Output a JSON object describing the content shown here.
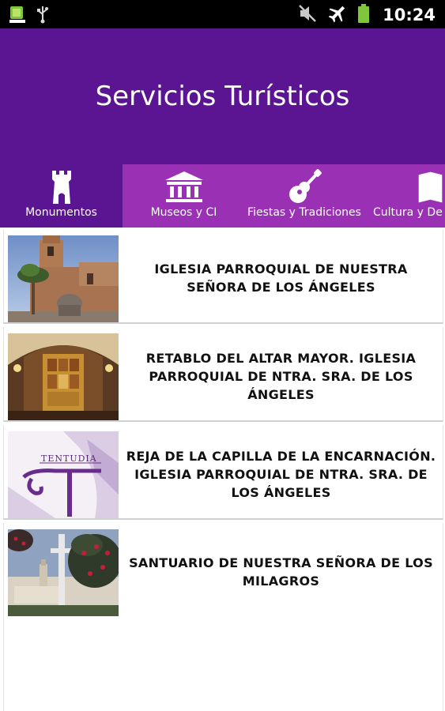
{
  "status_bar": {
    "time": "10:24",
    "icons": [
      "app-notification-icon",
      "usb-icon",
      "mute-icon",
      "airplane-mode-icon",
      "battery-icon"
    ]
  },
  "header": {
    "title": "Servicios Turísticos"
  },
  "tabs": [
    {
      "label": "Monumentos",
      "icon": "tower-icon",
      "active": true
    },
    {
      "label": "Museos y CI",
      "icon": "museum-icon",
      "active": false
    },
    {
      "label": "Fiestas y Tradiciones",
      "icon": "guitar-icon",
      "active": false
    },
    {
      "label": "Cultura y De",
      "icon": "book-icon",
      "active": false
    }
  ],
  "items": [
    {
      "title": "IGLESIA PARROQUIAL DE NUESTRA SEÑORA DE LOS ÁNGELES",
      "thumbnail": "church-exterior-photo"
    },
    {
      "title": "RETABLO DEL ALTAR MAYOR. IGLESIA PARROQUIAL DE NTRA. SRA. DE LOS ÁNGELES",
      "thumbnail": "altar-photo"
    },
    {
      "title": "REJA DE LA CAPILLA DE LA ENCARNACIÓN. IGLESIA PARROQUIAL DE NTRA. SRA. DE LOS ÁNGELES",
      "thumbnail": "tentudia-logo"
    },
    {
      "title": "SANTUARIO DE NUESTRA SEÑORA DE LOS MILAGROS",
      "thumbnail": "sanctuary-photo"
    }
  ],
  "logo_text": "TENTUDIA",
  "colors": {
    "header": "#5b1592",
    "tab_bar": "#9a30b4",
    "active_tab": "#5b1592",
    "status_bar": "#000000"
  }
}
